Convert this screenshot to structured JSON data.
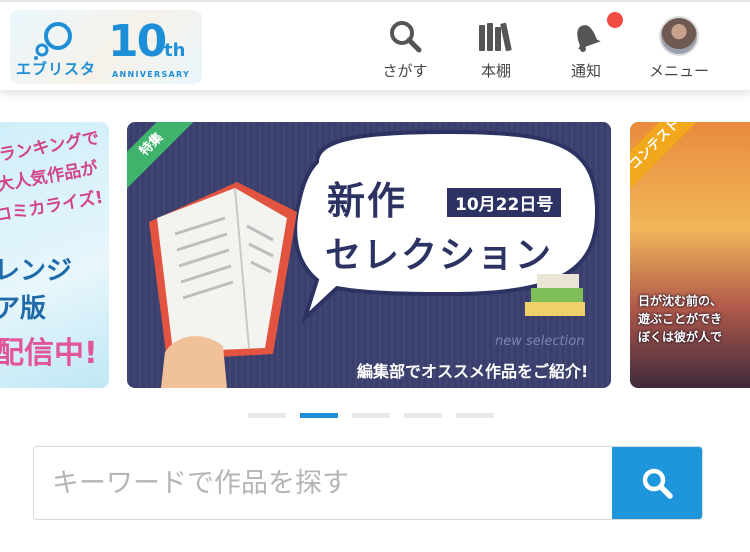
{
  "brand": {
    "name": "エブリスタ",
    "anniversary_number": "10",
    "anniversary_suffix": "th",
    "anniversary_label": "ANNIVERSARY",
    "accent": "#1e8fd6"
  },
  "nav": {
    "search_label": "さがす",
    "bookshelf_label": "本棚",
    "notifications_label": "通知",
    "menu_label": "メニュー",
    "notification_dot_color": "#f04b42"
  },
  "carousel": {
    "left_slide": {
      "lines_top": [
        "ランキングで",
        "大人気作品が",
        "コミカライズ!"
      ],
      "lines_bottom": [
        "レンジ",
        "ア版",
        "配信中!"
      ]
    },
    "main_slide": {
      "ribbon": "特集",
      "title": "新作",
      "date_tag": "10月22日号",
      "subtitle": "セレクション",
      "tagline": "new selection",
      "caption": "編集部でオススメ作品をご紹介!",
      "bg_color": "#3a3f6e"
    },
    "right_slide": {
      "ribbon": "コンテスト",
      "lines": [
        "日が沈む前の、",
        "遊ぶことができ",
        "ぼくは彼が人で"
      ]
    },
    "indicator_count": 5,
    "active_index": 1
  },
  "search": {
    "placeholder": "キーワードで作品を探す",
    "value": "",
    "button_color": "#1e96dc"
  }
}
